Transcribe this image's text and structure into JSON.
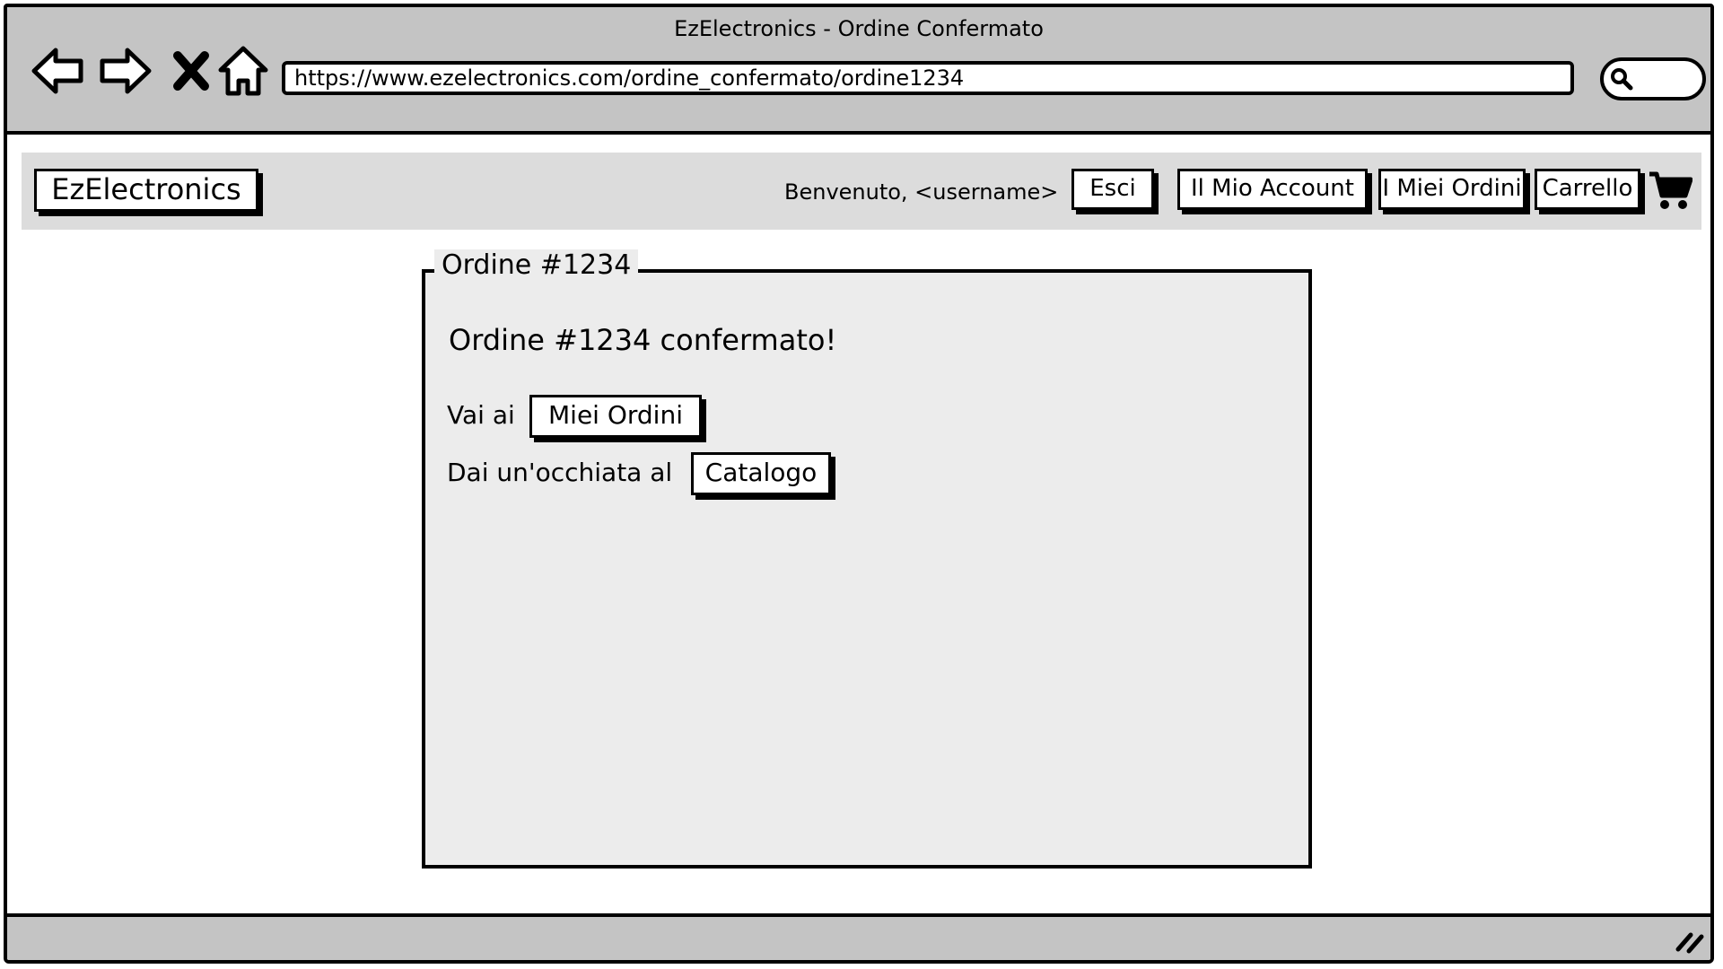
{
  "window": {
    "title": "EzElectronics - Ordine Confermato",
    "url": "https://www.ezelectronics.com/ordine_confermato/ordine1234"
  },
  "browser_icons": [
    "back-arrow-icon",
    "forward-arrow-icon",
    "stop-icon",
    "home-icon",
    "search-icon"
  ],
  "header": {
    "logo": "EzElectronics",
    "welcome": "Benvenuto, <username>",
    "buttons": {
      "logout": "Esci",
      "account": "Il Mio Account",
      "orders": "I Miei Ordini",
      "cart": "Carrello"
    },
    "cart_icon": "shopping-cart-icon"
  },
  "panel": {
    "legend": "Ordine #1234",
    "heading": "Ordine #1234 confermato!",
    "orders_row": {
      "label": "Vai ai",
      "button": "Miei Ordini"
    },
    "catalog_row": {
      "label": "Dai un'occhiata al",
      "button": "Catalogo"
    }
  },
  "colors": {
    "chrome": "#c4c4c4",
    "header_bg": "#dcdcdc",
    "panel_bg": "#ececec"
  }
}
